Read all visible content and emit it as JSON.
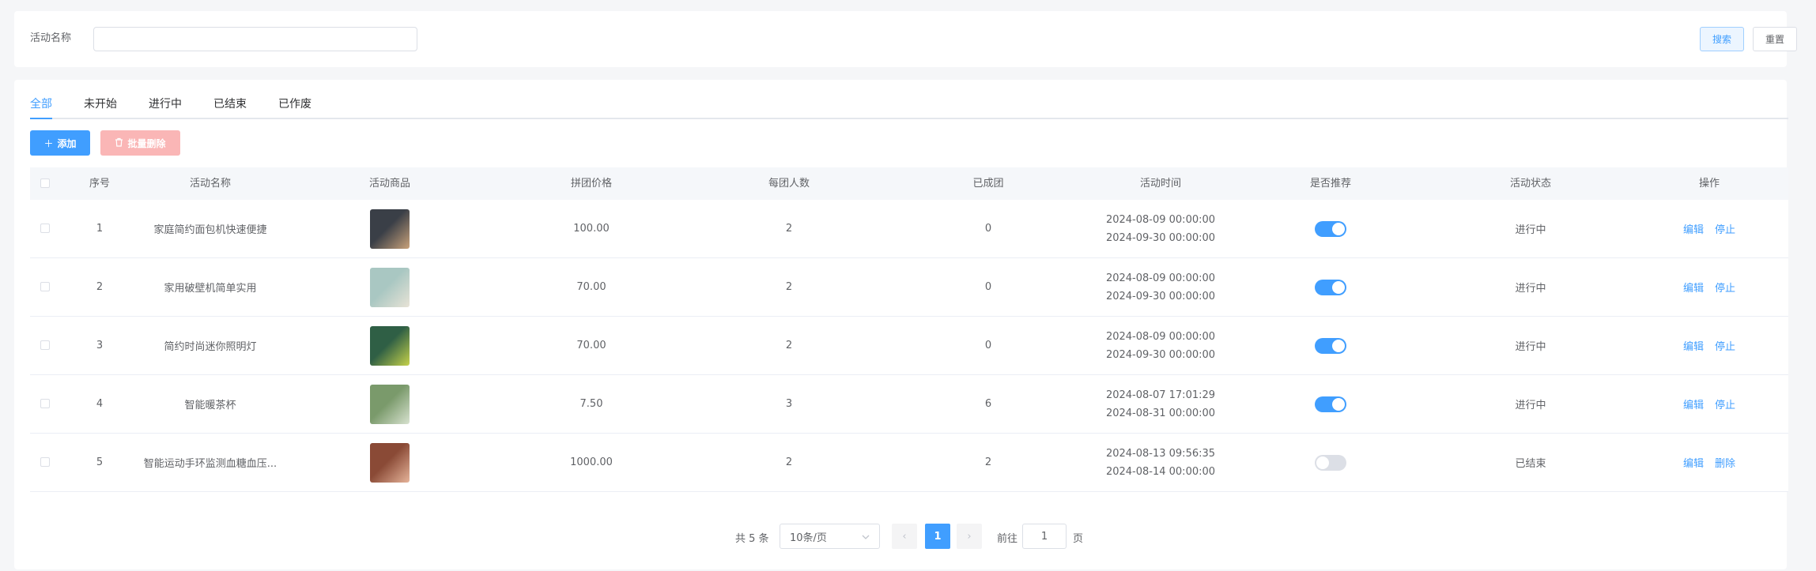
{
  "search": {
    "label": "活动名称",
    "value": "",
    "placeholder": "",
    "search_btn": "搜索",
    "reset_btn": "重置"
  },
  "tabs": [
    {
      "label": "全部",
      "active": true
    },
    {
      "label": "未开始",
      "active": false
    },
    {
      "label": "进行中",
      "active": false
    },
    {
      "label": "已结束",
      "active": false
    },
    {
      "label": "已作废",
      "active": false
    }
  ],
  "toolbar": {
    "add_label": "添加",
    "add_icon": "plus-icon",
    "bulk_delete_label": "批量删除",
    "bulk_delete_icon": "trash-icon"
  },
  "table": {
    "columns": [
      "序号",
      "活动名称",
      "活动商品",
      "拼团价格",
      "每团人数",
      "已成团",
      "活动时间",
      "是否推荐",
      "活动状态",
      "操作"
    ],
    "rows": [
      {
        "index": "1",
        "name": "家庭简约面包机快速便捷",
        "price": "100.00",
        "group_size": "2",
        "formed": "0",
        "start": "2024-08-09 00:00:00",
        "end": "2024-09-30 00:00:00",
        "recommended": true,
        "status": "进行中",
        "actions": [
          "编辑",
          "停止"
        ],
        "thumb_colors": [
          "#3a3f47",
          "#c9a27a"
        ]
      },
      {
        "index": "2",
        "name": "家用破壁机简单实用",
        "price": "70.00",
        "group_size": "2",
        "formed": "0",
        "start": "2024-08-09 00:00:00",
        "end": "2024-09-30 00:00:00",
        "recommended": true,
        "status": "进行中",
        "actions": [
          "编辑",
          "停止"
        ],
        "thumb_colors": [
          "#a9c7c2",
          "#e8e3d6"
        ]
      },
      {
        "index": "3",
        "name": "简约时尚迷你照明灯",
        "price": "70.00",
        "group_size": "2",
        "formed": "0",
        "start": "2024-08-09 00:00:00",
        "end": "2024-09-30 00:00:00",
        "recommended": true,
        "status": "进行中",
        "actions": [
          "编辑",
          "停止"
        ],
        "thumb_colors": [
          "#2f5f45",
          "#c6d24a"
        ]
      },
      {
        "index": "4",
        "name": "智能暖茶杯",
        "price": "7.50",
        "group_size": "3",
        "formed": "6",
        "start": "2024-08-07 17:01:29",
        "end": "2024-08-31 00:00:00",
        "recommended": true,
        "status": "进行中",
        "actions": [
          "编辑",
          "停止"
        ],
        "thumb_colors": [
          "#7a9a6b",
          "#d8e2d0"
        ]
      },
      {
        "index": "5",
        "name": "智能运动手环监测血糖血压...",
        "price": "1000.00",
        "group_size": "2",
        "formed": "2",
        "start": "2024-08-13 09:56:35",
        "end": "2024-08-14 00:00:00",
        "recommended": false,
        "status": "已结束",
        "actions": [
          "编辑",
          "删除"
        ],
        "thumb_colors": [
          "#8a4a36",
          "#e6b49a"
        ]
      }
    ]
  },
  "pagination": {
    "total": "共 5 条",
    "page_size": "10条/页",
    "current_page": "1",
    "goto_label": "前往",
    "goto_value": "1",
    "page_suffix": "页"
  },
  "colors": {
    "primary": "#409eff",
    "danger_light": "#fab6b6"
  }
}
